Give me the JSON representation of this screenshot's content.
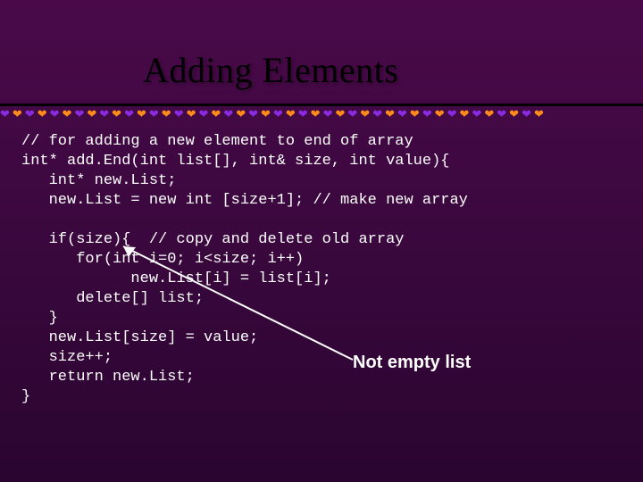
{
  "title": "Adding Elements",
  "annotation": "Not empty list",
  "code": "// for adding a new element to end of array\nint* add.End(int list[], int& size, int value){\n   int* new.List;\n   new.List = new int [size+1]; // make new array\n\n   if(size){  // copy and delete old array\n      for(int i=0; i<size; i++)\n            new.List[i] = list[i];\n      delete[] list;\n   }\n   new.List[size] = value;\n   size++;\n   return new.List;\n}"
}
